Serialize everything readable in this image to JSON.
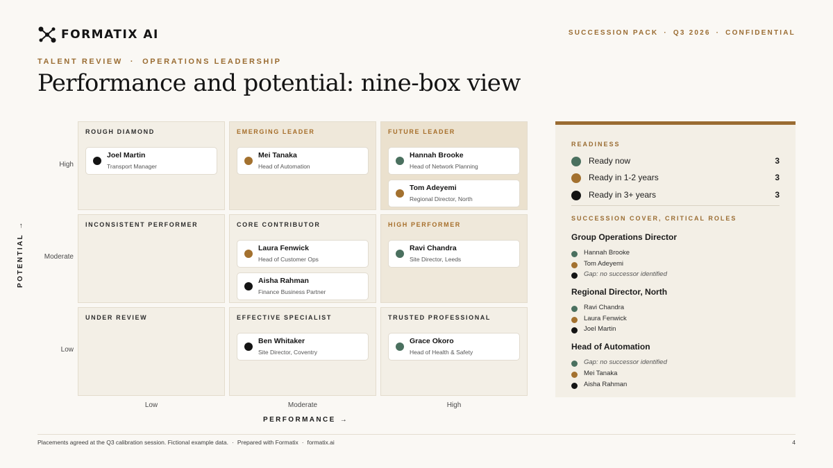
{
  "brand": {
    "name": "FORMATIX AI",
    "logo_icon": "molecule-network-icon"
  },
  "top_meta": [
    "SUCCESSION PACK",
    "Q3 2026",
    "CONFIDENTIAL"
  ],
  "eyebrow": {
    "section": "TALENT REVIEW",
    "topic": "OPERATIONS LEADERSHIP"
  },
  "title": "Performance and potential: nine-box view",
  "colors": {
    "ready_now": "#4a705f",
    "ready_1_2": "#a3712f",
    "ready_3_plus": "#141414",
    "accent": "#9a6c32"
  },
  "axes": {
    "y_title": "POTENTIAL",
    "x_title": "PERFORMANCE",
    "arrow": "→",
    "y_labels": [
      "High",
      "Moderate",
      "Low"
    ],
    "x_labels": [
      "Low",
      "Moderate",
      "High"
    ]
  },
  "grid": {
    "cells": [
      {
        "title": "ROUGH DIAMOND",
        "people": [
          {
            "name": "Joel Martin",
            "role": "Transport Manager",
            "readiness": "3_plus"
          }
        ]
      },
      {
        "title": "EMERGING LEADER",
        "people": [
          {
            "name": "Mei Tanaka",
            "role": "Head of Automation",
            "readiness": "1_2"
          }
        ]
      },
      {
        "title": "FUTURE LEADER",
        "people": [
          {
            "name": "Hannah Brooke",
            "role": "Head of Network Planning",
            "readiness": "now"
          },
          {
            "name": "Tom Adeyemi",
            "role": "Regional Director, North",
            "readiness": "1_2"
          }
        ]
      },
      {
        "title": "INCONSISTENT PERFORMER",
        "people": []
      },
      {
        "title": "CORE CONTRIBUTOR",
        "people": [
          {
            "name": "Laura Fenwick",
            "role": "Head of Customer Ops",
            "readiness": "1_2"
          },
          {
            "name": "Aisha Rahman",
            "role": "Finance Business Partner",
            "readiness": "3_plus"
          }
        ]
      },
      {
        "title": "HIGH PERFORMER",
        "people": [
          {
            "name": "Ravi Chandra",
            "role": "Site Director, Leeds",
            "readiness": "now"
          }
        ]
      },
      {
        "title": "UNDER REVIEW",
        "people": []
      },
      {
        "title": "EFFECTIVE SPECIALIST",
        "people": [
          {
            "name": "Ben Whitaker",
            "role": "Site Director, Coventry",
            "readiness": "3_plus"
          }
        ]
      },
      {
        "title": "TRUSTED PROFESSIONAL",
        "people": [
          {
            "name": "Grace Okoro",
            "role": "Head of Health & Safety",
            "readiness": "now"
          }
        ]
      }
    ]
  },
  "readiness": {
    "heading": "READINESS",
    "rows": [
      {
        "label": "Ready now",
        "count": "3",
        "key": "now"
      },
      {
        "label": "Ready in 1-2 years",
        "count": "3",
        "key": "1_2"
      },
      {
        "label": "Ready in 3+ years",
        "count": "3",
        "key": "3_plus"
      }
    ]
  },
  "succession": {
    "heading": "SUCCESSION COVER, CRITICAL ROLES",
    "roles": [
      {
        "title": "Group Operations Director",
        "successors": [
          {
            "text": "Hannah Brooke",
            "key": "now",
            "gap": false
          },
          {
            "text": "Tom Adeyemi",
            "key": "1_2",
            "gap": false
          },
          {
            "text": "Gap: no successor identified",
            "key": "3_plus",
            "gap": true
          }
        ]
      },
      {
        "title": "Regional Director, North",
        "successors": [
          {
            "text": "Ravi Chandra",
            "key": "now",
            "gap": false
          },
          {
            "text": "Laura Fenwick",
            "key": "1_2",
            "gap": false
          },
          {
            "text": "Joel Martin",
            "key": "3_plus",
            "gap": false
          }
        ]
      },
      {
        "title": "Head of Automation",
        "successors": [
          {
            "text": "Gap: no successor identified",
            "key": "now",
            "gap": true
          },
          {
            "text": "Mei Tanaka",
            "key": "1_2",
            "gap": false
          },
          {
            "text": "Aisha Rahman",
            "key": "3_plus",
            "gap": false
          }
        ]
      }
    ]
  },
  "footer": {
    "parts": [
      "Placements agreed at the Q3 calibration session. Fictional example data.",
      "Prepared with Formatix",
      "formatix.ai"
    ],
    "page": "4"
  }
}
